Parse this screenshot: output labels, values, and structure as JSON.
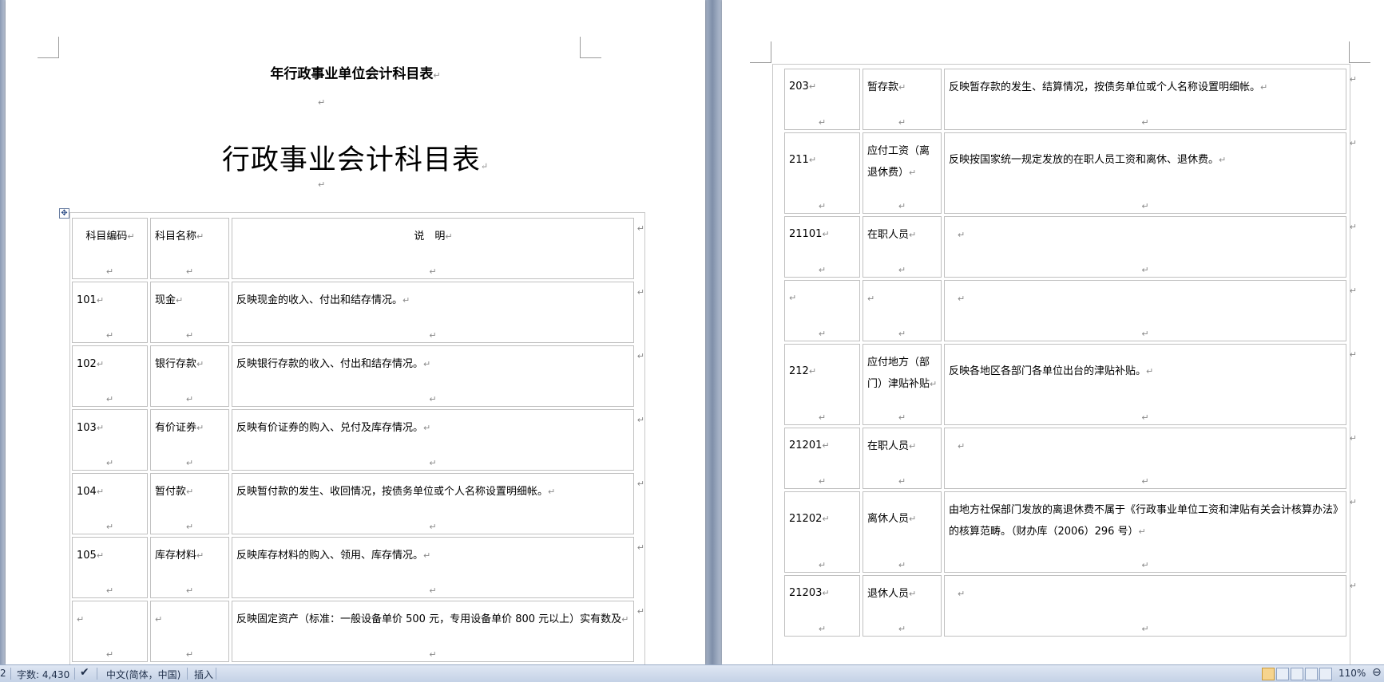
{
  "document": {
    "heading_small": "年行政事业单位会计科目表",
    "heading_large": "行政事业会计科目表",
    "paragraph_mark": "↵"
  },
  "table_left": {
    "headers": [
      "科目编码",
      "科目名称",
      "说　明"
    ],
    "rows": [
      {
        "code": "101",
        "name": "现金",
        "desc": "反映现金的收入、付出和结存情况。"
      },
      {
        "code": "102",
        "name": "银行存款",
        "desc": "反映银行存款的收入、付出和结存情况。"
      },
      {
        "code": "103",
        "name": "有价证券",
        "desc": "反映有价证券的购入、兑付及库存情况。"
      },
      {
        "code": "104",
        "name": "暂付款",
        "desc": "反映暂付款的发生、收回情况，按债务单位或个人名称设置明细帐。"
      },
      {
        "code": "105",
        "name": "库存材料",
        "desc": "反映库存材料的购入、领用、库存情况。"
      },
      {
        "code": "",
        "name": "",
        "desc": "反映固定资产（标准：一般设备单价 500 元，专用设备单价 800 元以上）实有数及"
      }
    ]
  },
  "table_right": {
    "rows": [
      {
        "code": "203",
        "name": "暂存款",
        "desc": "反映暂存款的发生、结算情况，按债务单位或个人名称设置明细帐。"
      },
      {
        "code": "211",
        "name": "应付工资（离退休费）",
        "desc": "反映按国家统一规定发放的在职人员工资和离休、退休费。"
      },
      {
        "code": "21101",
        "name": "在职人员",
        "desc": ""
      },
      {
        "code": "",
        "name": "",
        "desc": ""
      },
      {
        "code": "212",
        "name": "应付地方（部门）津贴补贴",
        "desc": "反映各地区各部门各单位出台的津贴补贴。"
      },
      {
        "code": "21201",
        "name": "在职人员",
        "desc": ""
      },
      {
        "code": "21202",
        "name": "离休人员",
        "desc": "由地方社保部门发放的离退休费不属于《行政事业单位工资和津贴有关会计核算办法》的核算范畴。（财办库（2006）296 号）"
      },
      {
        "code": "21203",
        "name": "退休人员",
        "desc": ""
      }
    ]
  },
  "statusbar": {
    "page_fragment": "2",
    "word_count": "字数: 4,430",
    "language": "中文(简体，中国)",
    "mode": "插入",
    "zoom": "110%"
  }
}
